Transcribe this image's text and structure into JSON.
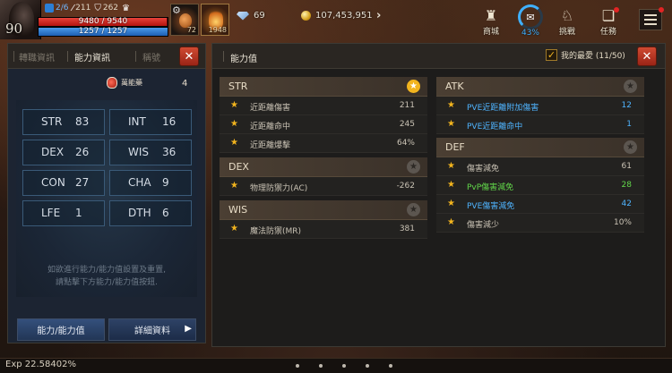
{
  "hud": {
    "level": "90",
    "buffs": [
      {
        "icon": "blue-buff-icon",
        "value": "2/6"
      },
      {
        "icon": "sword-icon",
        "value": "211"
      },
      {
        "icon": "shield-icon",
        "value": "262"
      },
      {
        "icon": "trophy-icon",
        "value": ""
      }
    ],
    "hp_text": "9480 / 9540",
    "hp_ratio": 0.9937,
    "mp_text": "1257 / 1257",
    "mp_ratio": 1.0,
    "slot1_count": "72",
    "slot2_count": "1948",
    "diamonds": "69",
    "gold": "107,453,951",
    "menu": [
      {
        "icon": "shop-bag-icon",
        "label": "商城"
      },
      {
        "icon": "quest-progress-icon",
        "label": "43%"
      },
      {
        "icon": "challenge-icon",
        "label": "挑戰"
      },
      {
        "icon": "task-scroll-icon",
        "label": "任務"
      }
    ]
  },
  "left_panel": {
    "tabs": [
      "轉職資訊",
      "能力資訊",
      "稱號"
    ],
    "potion_label": "萬能藥",
    "potion_count": "4",
    "stats": [
      {
        "key": "STR",
        "value": "83"
      },
      {
        "key": "INT",
        "value": "16"
      },
      {
        "key": "DEX",
        "value": "26"
      },
      {
        "key": "WIS",
        "value": "36"
      },
      {
        "key": "CON",
        "value": "27"
      },
      {
        "key": "CHA",
        "value": "9"
      },
      {
        "key": "LFE",
        "value": "1"
      },
      {
        "key": "DTH",
        "value": "6"
      }
    ],
    "hint_line1": "如欲進行能力/能力值設置及重置,",
    "hint_line2": "請點擊下方能力/能力值按鈕.",
    "btn_ability": "能力/能力值",
    "btn_detail": "詳細資料"
  },
  "right_panel": {
    "title": "能力值",
    "favorites": "我的最愛 (11/50)",
    "categories": {
      "str": {
        "name": "STR",
        "rows": [
          {
            "label": "近距離傷害",
            "value": "211"
          },
          {
            "label": "近距離命中",
            "value": "245"
          },
          {
            "label": "近距離爆擊",
            "value": "64%"
          }
        ]
      },
      "dex": {
        "name": "DEX",
        "rows": [
          {
            "label": "物理防禦力(AC)",
            "value": "-262"
          }
        ]
      },
      "wis": {
        "name": "WIS",
        "rows": [
          {
            "label": "魔法防禦(MR)",
            "value": "381"
          }
        ]
      },
      "atk": {
        "name": "ATK",
        "rows": [
          {
            "label": "PVE近距離附加傷害",
            "value": "12"
          },
          {
            "label": "PVE近距離命中",
            "value": "1"
          }
        ]
      },
      "def": {
        "name": "DEF",
        "rows": [
          {
            "label": "傷害減免",
            "value": "61"
          },
          {
            "label": "PvP傷害減免",
            "value": "28"
          },
          {
            "label": "PVE傷害減免",
            "value": "42"
          },
          {
            "label": "傷害減少",
            "value": "10%"
          }
        ]
      }
    }
  },
  "bottom": {
    "exp": "Exp 22.58402%"
  },
  "colors": {
    "star_gold": "#f2b41e",
    "pve_blue": "#4fb4ff",
    "pvp_green": "#62d84a",
    "close_red": "#c23a26"
  }
}
